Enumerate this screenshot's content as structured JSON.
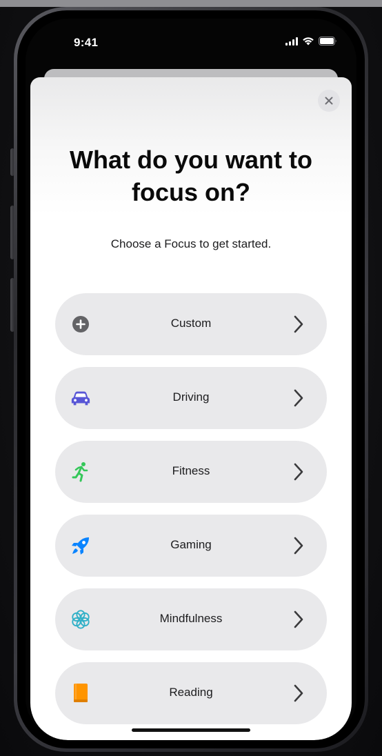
{
  "status_bar": {
    "time": "9:41",
    "signal_icon": "cellular-signal-icon",
    "wifi_icon": "wifi-icon",
    "battery_icon": "battery-icon"
  },
  "sheet": {
    "close_icon": "close-icon",
    "title": "What do you want to focus on?",
    "subtitle": "Choose a Focus to get started."
  },
  "focus_options": [
    {
      "label": "Custom",
      "icon": "plus-circle-icon",
      "color": "#636366"
    },
    {
      "label": "Driving",
      "icon": "car-icon",
      "color": "#5856D6"
    },
    {
      "label": "Fitness",
      "icon": "running-figure-icon",
      "color": "#34C759"
    },
    {
      "label": "Gaming",
      "icon": "rocket-icon",
      "color": "#0A84FF"
    },
    {
      "label": "Mindfulness",
      "icon": "flower-icon",
      "color": "#30B0C7"
    },
    {
      "label": "Reading",
      "icon": "book-icon",
      "color": "#FF9500"
    }
  ],
  "chevron_icon": "chevron-right-icon"
}
